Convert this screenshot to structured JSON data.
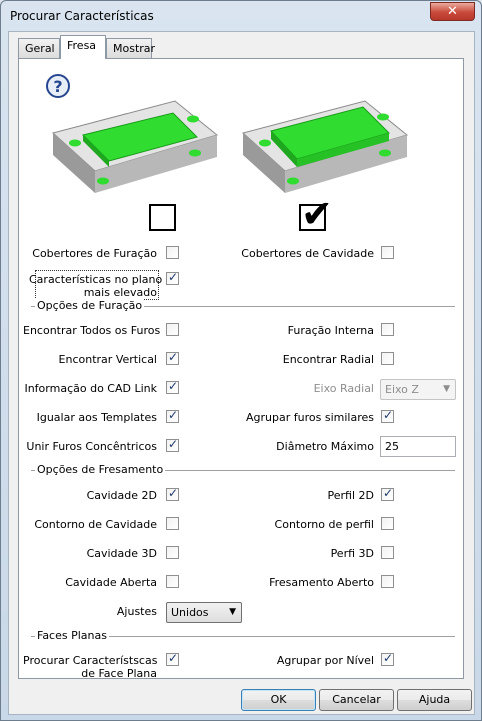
{
  "window": {
    "title": "Procurar Características",
    "close_glyph": "✕"
  },
  "tabs": [
    {
      "label": "Geral",
      "active": false
    },
    {
      "label": "Fresa",
      "active": true
    },
    {
      "label": "Mostrar",
      "active": false
    }
  ],
  "help_icon": "?",
  "illustration": {
    "checked_glyph": "✔"
  },
  "top_options": {
    "cobertores_furacao": {
      "label": "Cobertores de Furação",
      "checked": false
    },
    "cobertores_cavidade": {
      "label": "Cobertores de Cavidade",
      "checked": false
    },
    "plano_elevado": {
      "label_line1": "Características no plano",
      "label_line2": "mais elevado",
      "checked": true
    }
  },
  "furacao": {
    "title": "Opções de Furação",
    "todos_furos": {
      "label": "Encontrar Todos os Furos",
      "checked": false
    },
    "furacao_interna": {
      "label": "Furação Interna",
      "checked": false
    },
    "vertical": {
      "label": "Encontrar Vertical",
      "checked": true
    },
    "radial": {
      "label": "Encontrar Radial",
      "checked": false
    },
    "cad_link": {
      "label": "Informação do CAD Link",
      "checked": true
    },
    "eixo_radial_label": "Eixo Radial",
    "eixo_radial_value": "Eixo Z",
    "templates": {
      "label": "Igualar aos Templates",
      "checked": true
    },
    "agrupar_similares": {
      "label": "Agrupar furos similares",
      "checked": true
    },
    "concentricos": {
      "label": "Unir Furos Concêntricos",
      "checked": true
    },
    "diametro_label": "Diâmetro Máximo",
    "diametro_value": "25"
  },
  "fresamento": {
    "title": "Opções de Fresamento",
    "cavidade_2d": {
      "label": "Cavidade 2D",
      "checked": true
    },
    "perfil_2d": {
      "label": "Perfil 2D",
      "checked": true
    },
    "contorno_cavidade": {
      "label": "Contorno de Cavidade",
      "checked": false
    },
    "contorno_perfil": {
      "label": "Contorno de perfil",
      "checked": false
    },
    "cavidade_3d": {
      "label": "Cavidade 3D",
      "checked": false
    },
    "perfil_3d": {
      "label": "Perfi 3D",
      "checked": false
    },
    "cavidade_aberta": {
      "label": "Cavidade Aberta",
      "checked": false
    },
    "fresamento_aberto": {
      "label": "Fresamento Aberto",
      "checked": false
    },
    "ajustes_label": "Ajustes",
    "ajustes_value": "Unidos"
  },
  "faces": {
    "title": "Faces Planas",
    "procurar": {
      "label_line1": "Procurar Característscas",
      "label_line2": "de Face Plana",
      "checked": true
    },
    "agrupar_nivel": {
      "label": "Agrupar por Nível",
      "checked": true
    }
  },
  "buttons": {
    "ok": "OK",
    "cancel": "Cancelar",
    "help": "Ajuda"
  },
  "colors": {
    "pocket_green": "#2fdc2f",
    "part_gray": "#c8c8c8"
  }
}
